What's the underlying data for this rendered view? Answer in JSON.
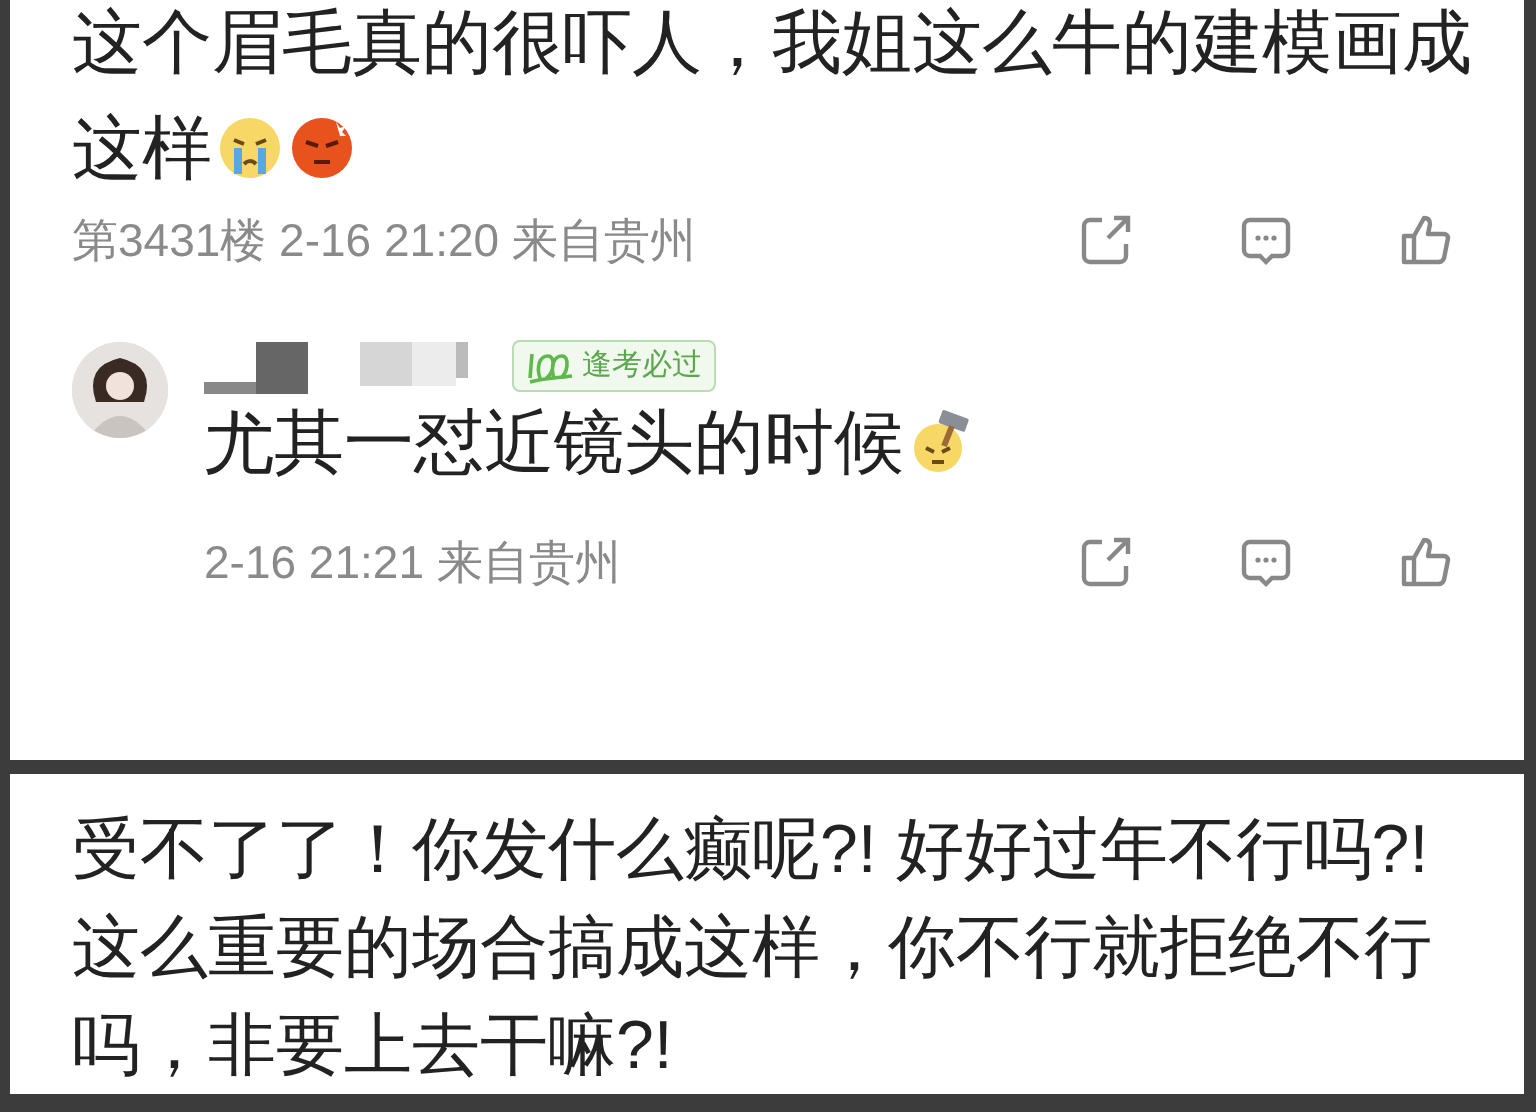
{
  "comment": {
    "text": "这个眉毛真的很吓人，我姐这么牛的建模画成这样",
    "emojis": [
      {
        "kind": "crying"
      },
      {
        "kind": "angry"
      }
    ],
    "meta": "第3431楼 2-16 21:20 来自贵州",
    "actions": [
      {
        "kind": "share"
      },
      {
        "kind": "comment"
      },
      {
        "kind": "like"
      }
    ]
  },
  "reply": {
    "badge": "逢考必过",
    "text": "尤其一怼近镜头的时候",
    "emojis": [
      {
        "kind": "hammer"
      }
    ],
    "meta": "2-16 21:21 来自贵州",
    "actions": [
      {
        "kind": "share"
      },
      {
        "kind": "comment"
      },
      {
        "kind": "like"
      }
    ]
  },
  "second_post": {
    "text": "受不了了！你发什么癫呢?! 好好过年不行吗?! 这么重要的场合搞成这样，你不行就拒绝不行吗，非要上去干嘛?!"
  }
}
